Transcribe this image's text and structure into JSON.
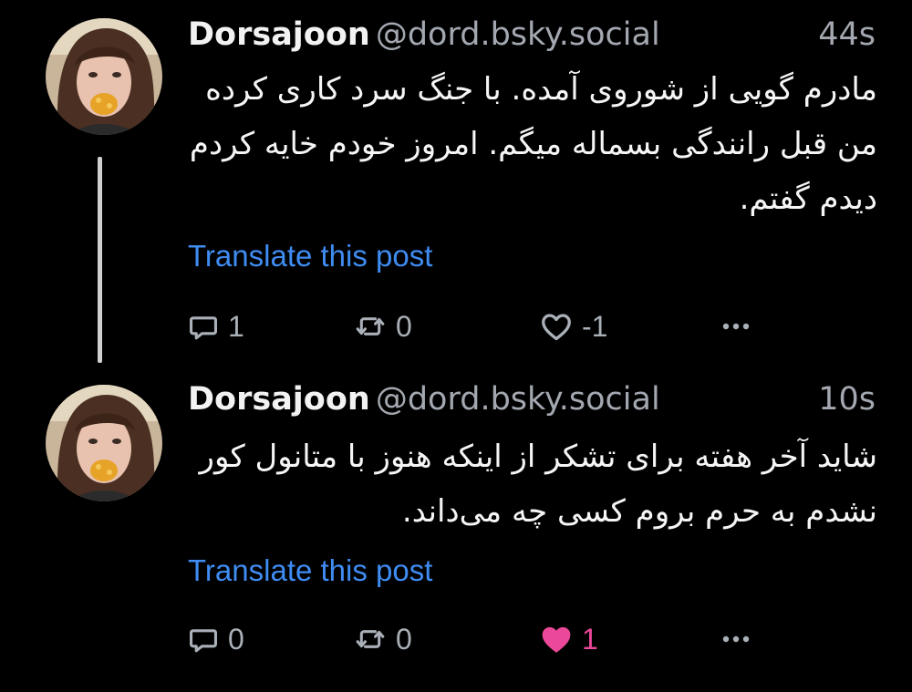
{
  "posts": [
    {
      "author": {
        "display_name": "Dorsajoon",
        "handle": "@dord.bsky.social"
      },
      "timestamp": "44s",
      "text": "مادرم گویی از شوروی آمده. با جنگ سرد کاری کرده من قبل رانندگی بسماله میگم. امروز خودم خایه کردم دیدم گفتم.",
      "translate_label": "Translate this post",
      "reply_count": "1",
      "repost_count": "0",
      "like_count": "-1",
      "liked": false,
      "icons": {
        "reply": "reply-icon",
        "repost": "repost-icon",
        "like": "heart-outline-icon",
        "more": "more-icon"
      }
    },
    {
      "author": {
        "display_name": "Dorsajoon",
        "handle": "@dord.bsky.social"
      },
      "timestamp": "10s",
      "text": "شاید آخر هفته برای تشکر از اینکه هنوز با متانول کور نشدم به حرم بروم کسی چه می‌داند.",
      "translate_label": "Translate this post",
      "reply_count": "0",
      "repost_count": "0",
      "like_count": "1",
      "liked": true,
      "icons": {
        "reply": "reply-icon",
        "repost": "repost-icon",
        "like": "heart-filled-icon",
        "more": "more-icon"
      }
    }
  ],
  "colors": {
    "background": "#000000",
    "link": "#3f8cf2",
    "muted": "#aab0b8",
    "like_active": "#ec4899"
  }
}
